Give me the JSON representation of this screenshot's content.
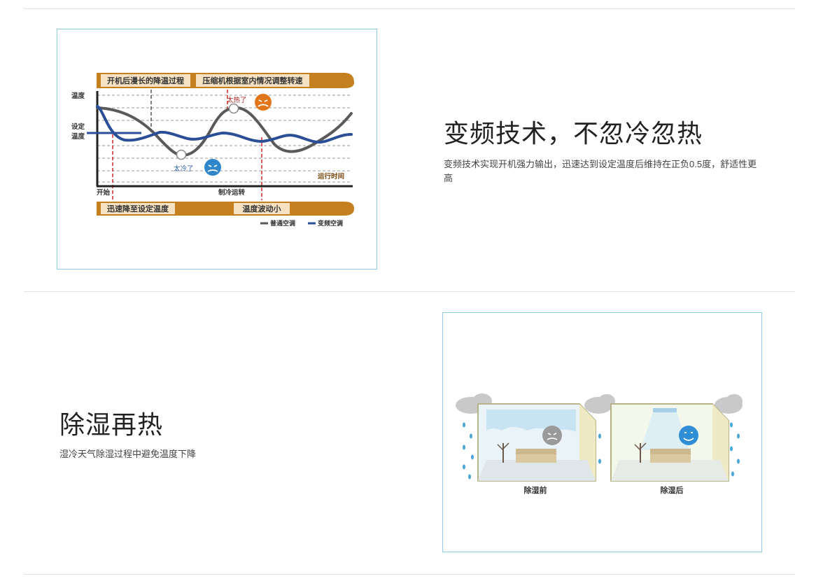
{
  "section1": {
    "title": "变频技术，不忽冷忽热",
    "description": "变频技术实现开机强力输出，迅速达到设定温度后维持在正负0.5度，舒适性更高",
    "diagram": {
      "header_left": "开机后漫长的降温过程",
      "header_right": "压缩机根据室内情况调整转速",
      "ylabel_top": "温度",
      "ylabel_set_line1": "设定",
      "ylabel_set_line2": "温度",
      "label_too_hot": "太热了",
      "label_too_cold": "太冷了",
      "label_runtime": "运行时间",
      "label_start": "开始",
      "label_cooling": "制冷运转",
      "footer_left": "迅速降至设定温度",
      "footer_right": "温度波动小",
      "legend_normal": "普通空调",
      "legend_inverter": "变频空调",
      "colors": {
        "banner": "#c4801f",
        "banner_text_bg": "#f6e2c2",
        "normal": "#5a5a5a",
        "inverter": "#2a4f96",
        "marker": "#d32626"
      }
    }
  },
  "section2": {
    "title": "除湿再热",
    "description": "湿冷天气除湿过程中避免温度下降",
    "illustration": {
      "label_before": "除湿前",
      "label_after": "除湿后"
    }
  }
}
